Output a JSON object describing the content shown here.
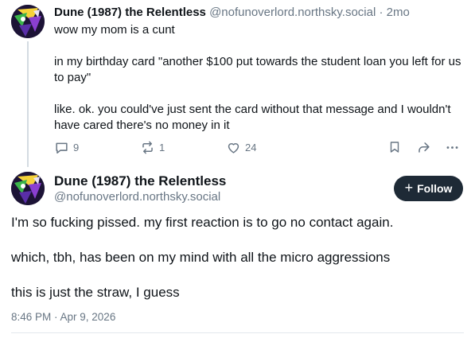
{
  "parent_post": {
    "display_name": "Dune (1987) the Relentless",
    "handle": "@nofunoverlord.northsky.social",
    "separator": "·",
    "age": "2mo",
    "paragraphs": [
      "wow my mom is a cunt",
      "in my birthday card \"another $100 put towards the student loan you left for us to pay\"",
      "like. ok. you could've just sent the card without that message and I wouldn't have cared there's no money in it"
    ],
    "actions": {
      "reply_count": "9",
      "repost_count": "1",
      "like_count": "24",
      "icons": [
        "reply-icon",
        "repost-icon",
        "like-icon",
        "bookmark-icon",
        "share-icon",
        "more-icon"
      ]
    }
  },
  "main_post": {
    "display_name": "Dune (1987) the Relentless",
    "handle": "@nofunoverlord.northsky.social",
    "follow_plus": "+",
    "follow_label": "Follow",
    "paragraphs": [
      "I'm so fucking pissed. my first reaction is to go no contact again.",
      "which, tbh, has been on my mind with all the micro aggressions",
      "this is just the straw, I guess"
    ],
    "timestamp": "8:46 PM · Apr 9, 2026"
  },
  "colors": {
    "text": "#0f1419",
    "muted": "#687684",
    "follow_bg": "#1e2a36",
    "thread_line": "#d4dbe2"
  }
}
